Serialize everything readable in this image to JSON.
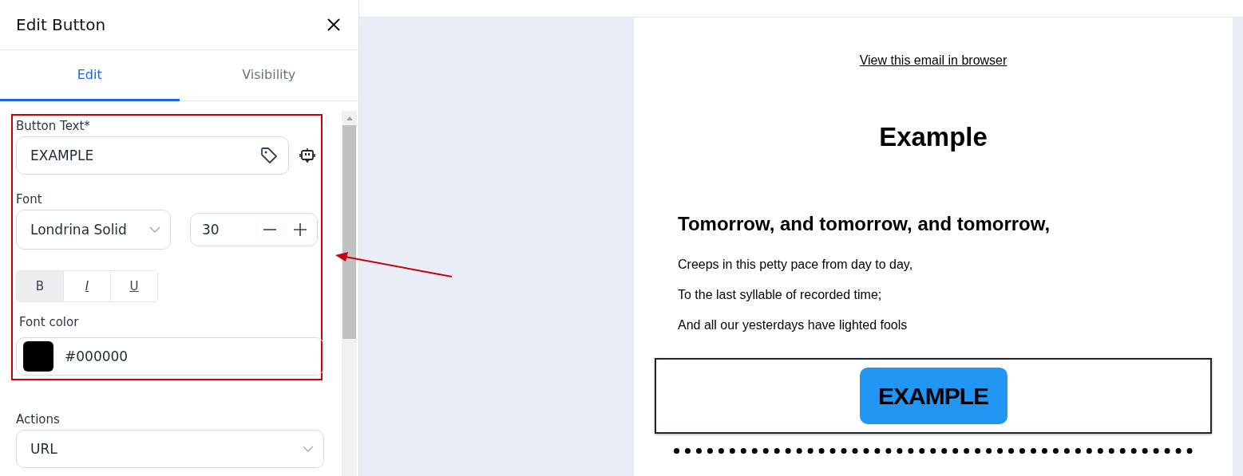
{
  "panel": {
    "title": "Edit Button",
    "tabs": [
      {
        "label": "Edit",
        "selected": true
      },
      {
        "label": "Visibility",
        "selected": false
      }
    ],
    "button_text": {
      "label": "Button Text*",
      "value": "EXAMPLE"
    },
    "font": {
      "label": "Font",
      "value": "Londrina Solid",
      "size": "30"
    },
    "styles": [
      {
        "label": "B",
        "kind": "bold",
        "selected": true
      },
      {
        "label": "I",
        "kind": "italic",
        "selected": false
      },
      {
        "label": "U",
        "kind": "underline",
        "selected": false
      }
    ],
    "font_color": {
      "label": "Font color",
      "value": "#000000"
    },
    "actions": {
      "label": "Actions",
      "value": "URL"
    }
  },
  "email": {
    "browser_link": "View this email in browser",
    "title": "Example",
    "heading": "Tomorrow, and tomorrow, and tomorrow,",
    "lines": [
      "Creeps in this petty pace from day to day,",
      "To the last syllable of recorded time;",
      "And all our yesterdays have lighted fools"
    ],
    "button_label": "EXAMPLE"
  }
}
